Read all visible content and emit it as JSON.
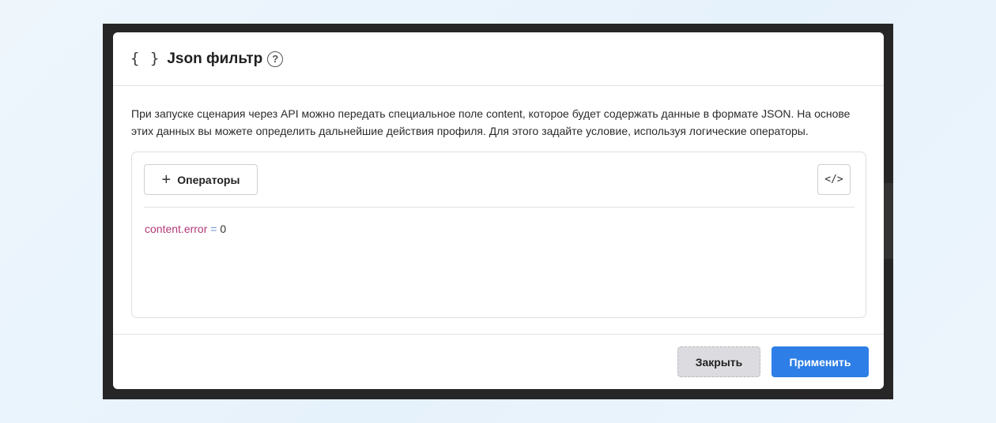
{
  "dialog": {
    "title": "Json фильтр",
    "icon": "braces-icon",
    "icon_glyph": "{ }",
    "help_glyph": "?"
  },
  "description": "При запуске сценария через API можно передать специальное поле content, которое будет содержать данные в формате JSON. На основе этих данных вы можете определить дальнейшие действия профиля. Для этого задайте условие, используя логические операторы.",
  "editor": {
    "operators_label": "Операторы",
    "operators_glyph": "+",
    "code_toggle_glyph": "</>",
    "expression": {
      "key": "content.error",
      "operator": "=",
      "value": "0"
    }
  },
  "footer": {
    "close_label": "Закрыть",
    "apply_label": "Применить"
  },
  "colors": {
    "accent": "#2d7ee6",
    "code_key": "#b23a76",
    "code_operator": "#6e8fd6"
  }
}
